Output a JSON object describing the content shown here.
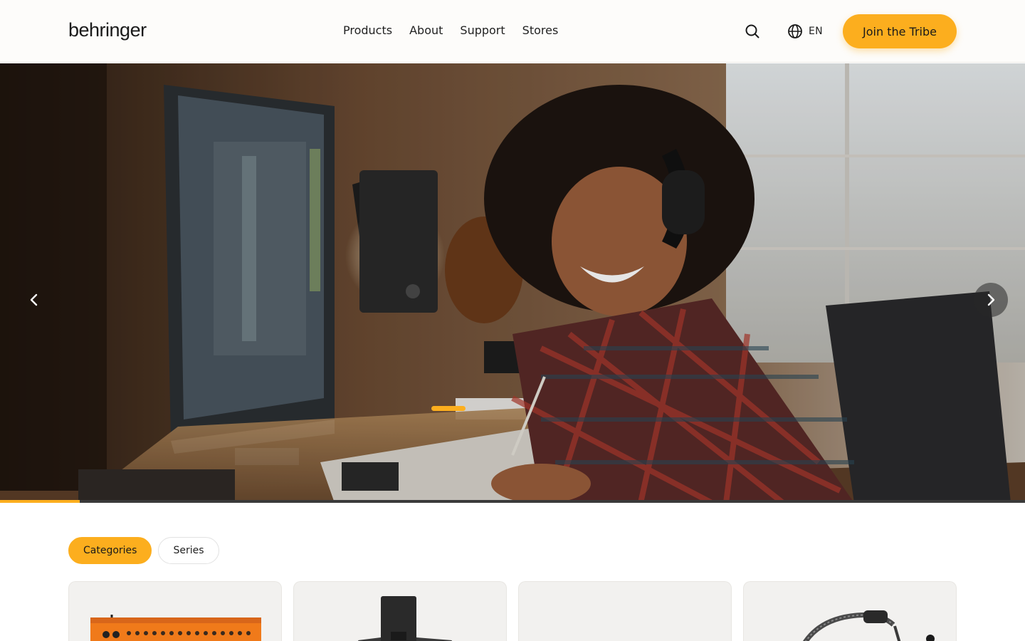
{
  "header": {
    "logo_text": "behringer",
    "nav": [
      "Products",
      "About",
      "Support",
      "Stores"
    ],
    "search_icon": "search-icon",
    "language": {
      "icon": "globe-icon",
      "label": "EN"
    },
    "cta_label": "Join the Tribe"
  },
  "hero": {
    "prev_icon": "chevron-left-icon",
    "next_icon": "chevron-right-icon",
    "slide_progress": 0.078
  },
  "tabs": [
    {
      "label": "Categories",
      "active": true
    },
    {
      "label": "Series",
      "active": false
    }
  ],
  "cards": [
    {
      "image": "orange digital mixer"
    },
    {
      "image": "loudspeaker column"
    },
    {
      "image": "empty"
    },
    {
      "image": "headset microphone"
    }
  ],
  "colors": {
    "accent": "#fcae1e",
    "header_bg": "#fdfcfa",
    "card_bg": "#f2f1ef"
  }
}
